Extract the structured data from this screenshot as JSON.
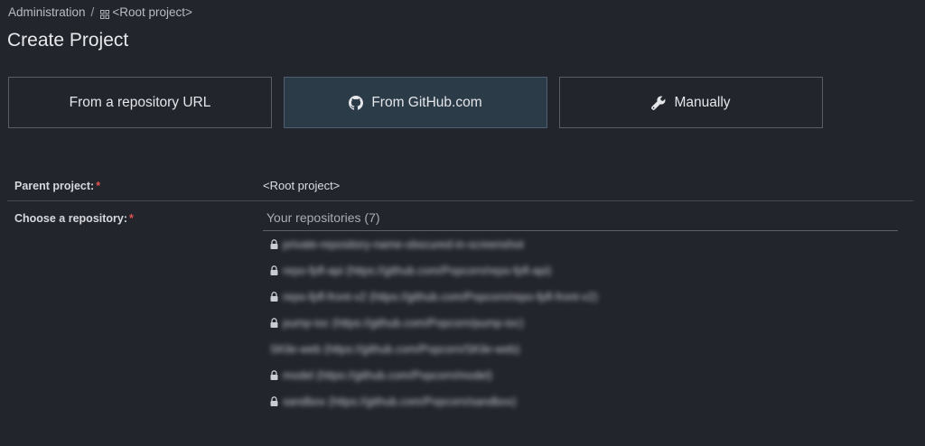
{
  "breadcrumb": {
    "root": "Administration",
    "separator": "/",
    "current": "<Root project>"
  },
  "page": {
    "title": "Create Project"
  },
  "tabs": [
    {
      "label": "From a repository URL",
      "icon": "none",
      "active": false
    },
    {
      "label": "From GitHub.com",
      "icon": "github-icon",
      "active": true
    },
    {
      "label": "Manually",
      "icon": "wrench-icon",
      "active": false
    }
  ],
  "form": {
    "parent_label": "Parent project:",
    "parent_required": "*",
    "parent_value": "<Root project>",
    "repo_label": "Choose a repository:",
    "repo_required": "*"
  },
  "repositories": {
    "header": "Your repositories (7)",
    "items": [
      {
        "name": "private-repository-name-obscured-in-screenshot",
        "locked": true
      },
      {
        "name": "repo-fpfl-api (https://github.com/Popcorn/repo-fpfl-api)",
        "locked": true
      },
      {
        "name": "repo-fpfl-front-v2 (https://github.com/Popcorn/repo-fpfl-front-v2)",
        "locked": true
      },
      {
        "name": "pump-ioc (https://github.com/Popcorn/pump-ioc)",
        "locked": true
      },
      {
        "name": "SKile-web (https://github.com/Popcorn/SKile-web)",
        "locked": false
      },
      {
        "name": "model (https://github.com/Popcorn/model)",
        "locked": true
      },
      {
        "name": "sandbox (https://github.com/Popcorn/sandbox)",
        "locked": true
      }
    ]
  },
  "colors": {
    "background": "#23252c",
    "active_tab": "#2c3b48",
    "required_mark": "#e0534f",
    "border": "#5a5e68"
  }
}
